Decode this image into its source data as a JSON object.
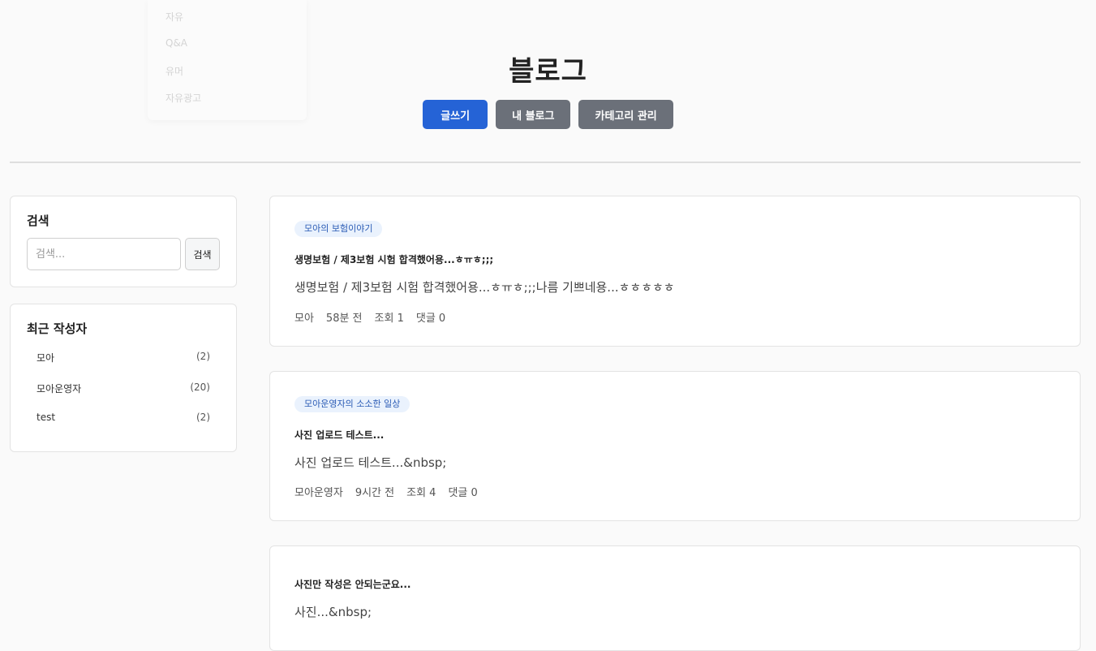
{
  "nav_menu": {
    "items": [
      "자유",
      "Q&A",
      "유머",
      "자유광고"
    ]
  },
  "header": {
    "title": "블로그",
    "buttons": {
      "write": "글쓰기",
      "my_blog": "내 블로그",
      "category": "카테고리 관리"
    }
  },
  "sidebar": {
    "search": {
      "title": "검색",
      "placeholder": "검색...",
      "button": "검색"
    },
    "authors": {
      "title": "최근 작성자",
      "items": [
        {
          "name": "모아",
          "count": "(2)"
        },
        {
          "name": "모아운영자",
          "count": "(20)"
        },
        {
          "name": "test",
          "count": "(2)"
        }
      ]
    }
  },
  "posts": [
    {
      "tag": "모아의 보험이야기",
      "title": "생명보험 / 제3보험 시험 합격했어용...ㅎㅠㅎ;;;",
      "excerpt": "생명보험 / 제3보험 시험 합격했어용...ㅎㅠㅎ;;;나름 기쁘네용...ㅎㅎㅎㅎㅎ",
      "author": "모아",
      "time": "58분 전",
      "views": "조회 1",
      "comments": "댓글 0"
    },
    {
      "tag": "모아운영자의 소소한 일상",
      "title": "사진 업로드 테스트...",
      "excerpt": "사진 업로드 테스트...&nbsp;",
      "author": "모아운영자",
      "time": "9시간 전",
      "views": "조회 4",
      "comments": "댓글 0"
    },
    {
      "tag": "",
      "title": "사진만 작성은 안되는군요...",
      "excerpt": "사진...&nbsp;"
    }
  ],
  "colors": {
    "primary": "#2563d6",
    "secondary": "#6b7079",
    "tag_bg": "#eaf2fd",
    "tag_text": "#2a5bb5"
  }
}
